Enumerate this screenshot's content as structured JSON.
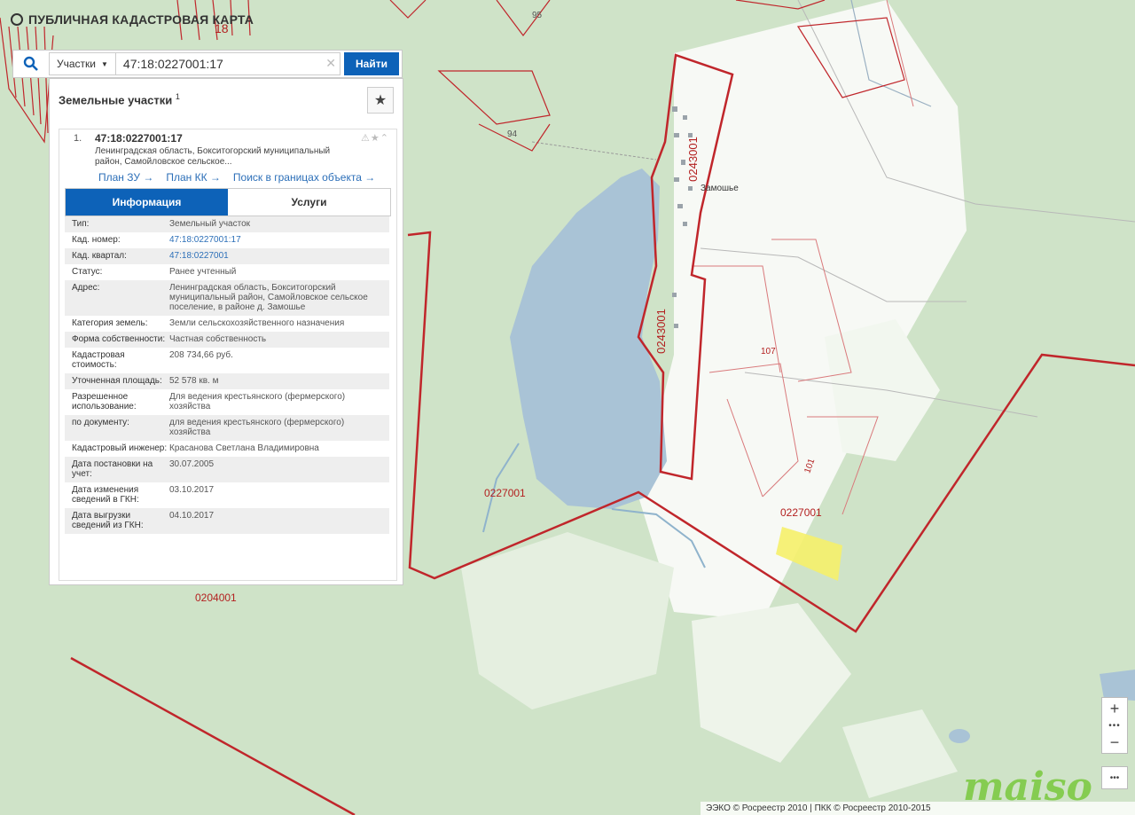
{
  "app": {
    "title": "ПУБЛИЧНАЯ КАДАСТРОВАЯ КАРТА"
  },
  "search": {
    "type_label": "Участки",
    "value": "47:18:0227001:17",
    "button": "Найти"
  },
  "panel": {
    "title": "Земельные участки",
    "count": "1",
    "result": {
      "index": "1.",
      "cad_number": "47:18:0227001:17",
      "address_short": "Ленинградская область, Бокситогорский муниципальный район, Самойловское сельское...",
      "links": [
        "План ЗУ →",
        "План КК →",
        "Поиск в границах объекта →"
      ]
    },
    "tabs": [
      "Информация",
      "Услуги"
    ],
    "fields": [
      {
        "key": "Тип:",
        "value": "Земельный участок"
      },
      {
        "key": "Кад. номер:",
        "value": "47:18:0227001:17"
      },
      {
        "key": "Кад. квартал:",
        "value": "47:18:0227001"
      },
      {
        "key": "Статус:",
        "value": "Ранее учтенный"
      },
      {
        "key": "Адрес:",
        "value": "Ленинградская область, Бокситогорский муниципальный район, Самойловское сельское поселение, в районе д. Замошье"
      },
      {
        "key": "Категория земель:",
        "value": "Земли сельскохозяйственного назначения"
      },
      {
        "key": "Форма собственности:",
        "value": "Частная собственность"
      },
      {
        "key": "Кадастровая стоимость:",
        "value": "208 734,66 руб."
      },
      {
        "key": "Уточненная площадь:",
        "value": "52 578 кв. м"
      },
      {
        "key": "Разрешенное использование:",
        "value": "Для ведения крестьянского (фермерского) хозяйства"
      },
      {
        "key": "по документу:",
        "value": "для ведения крестьянского (фермерского) хозяйства"
      },
      {
        "key": "Кадастровый инженер:",
        "value": "Красанова Светлана Владимировна"
      },
      {
        "key": "Дата постановки на учет:",
        "value": "30.07.2005"
      },
      {
        "key": "Дата изменения сведений в ГКН:",
        "value": "03.10.2017"
      },
      {
        "key": "Дата выгрузки сведений из ГКН:",
        "value": "04.10.2017"
      }
    ]
  },
  "map_labels": {
    "q0243001_a": "0243001",
    "q0243001_b": "0243001",
    "q0227001_a": "0227001",
    "q0227001_b": "0227001",
    "q0204001": "0204001",
    "village": "Замошье",
    "n95": "95",
    "n94": "94",
    "n107": "107",
    "n101": "101",
    "n18": "18"
  },
  "zoom": {
    "plus": "+",
    "minus": "−"
  },
  "footer": "ЭЭКО © Росреестр 2010 | ПКК © Росреестр 2010-2015",
  "watermark": "maiso",
  "colors": {
    "accent": "#0d62b8",
    "boundary": "#c0262b",
    "water": "#a9c3d6",
    "forest": "#cfe3c8",
    "highlight": "#f5f06a"
  }
}
